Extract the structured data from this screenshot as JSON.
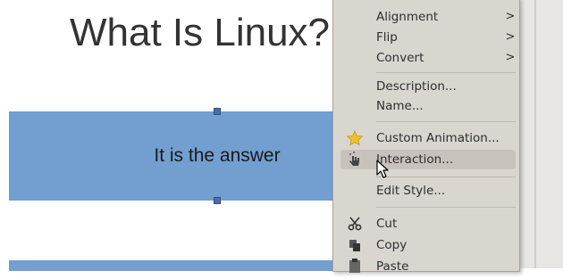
{
  "slide": {
    "title": "What Is Linux?",
    "shape_text": "It is the answer"
  },
  "context_menu": {
    "items": [
      {
        "label": "Alignment",
        "submenu": true
      },
      {
        "label": "Flip",
        "submenu": true
      },
      {
        "label": "Convert",
        "submenu": true
      },
      {
        "label": "Description..."
      },
      {
        "label": "Name..."
      },
      {
        "label": "Custom Animation...",
        "icon": "star-icon"
      },
      {
        "label": "Interaction...",
        "icon": "interaction-hand-icon",
        "highlighted": true
      },
      {
        "label": "Edit Style..."
      },
      {
        "label": "Cut",
        "icon": "scissors-icon"
      },
      {
        "label": "Copy",
        "icon": "copy-icon"
      },
      {
        "label": "Paste",
        "icon": "paste-icon"
      }
    ],
    "submenu_arrow": ">"
  }
}
